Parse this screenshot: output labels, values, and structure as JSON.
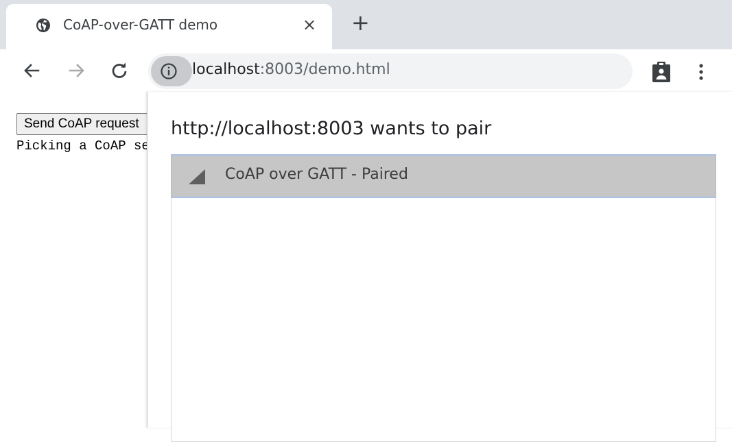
{
  "browser": {
    "tab": {
      "title": "CoAP-over-GATT demo",
      "close_glyph": "×",
      "favicon": "globe-icon"
    },
    "new_tab_glyph": "+",
    "address": {
      "host": "localhost",
      "rest": ":8003/demo.html"
    },
    "icons": {
      "back": "arrow-left-icon",
      "forward": "arrow-right-icon",
      "reload": "reload-icon",
      "info": "info-icon",
      "extension": "clipboard-icon",
      "menu": "more-vert-icon"
    },
    "colors": {
      "tabstrip": "#dee1e6",
      "omnibox": "#f1f3f4"
    }
  },
  "page": {
    "send_button_label": "Send CoAP request",
    "log_text": "Picking a CoAP server..."
  },
  "chooser": {
    "title": "http://localhost:8003 wants to pair",
    "devices": [
      {
        "name": "CoAP over GATT - Paired",
        "icon": "signal-strength-icon",
        "selected": true
      }
    ],
    "colors": {
      "selected_row": "#c6c6c6",
      "selected_border": "#a9c2e6"
    }
  }
}
